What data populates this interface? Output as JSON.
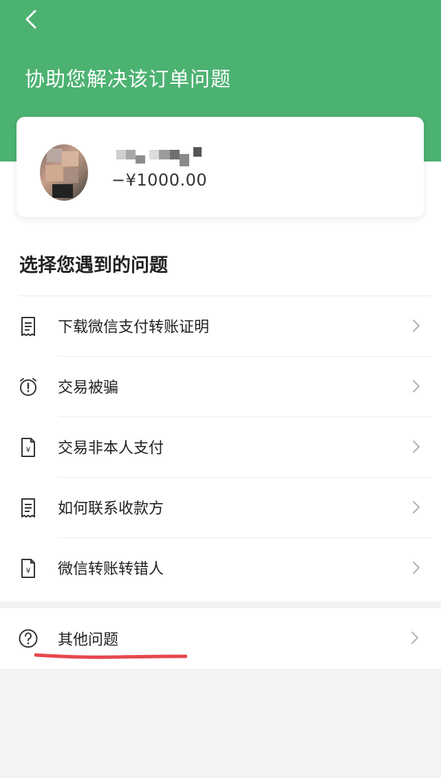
{
  "header": {
    "title": "协助您解决该订单问题",
    "back_icon": "chevron-left-icon",
    "background": "#4cb271"
  },
  "order": {
    "amount": "−¥1000.00"
  },
  "section": {
    "title": "选择您遇到的问题"
  },
  "problems": [
    {
      "label": "下载微信支付转账证明",
      "icon": "receipt-icon"
    },
    {
      "label": "交易被骗",
      "icon": "alert-clock-icon"
    },
    {
      "label": "交易非本人支付",
      "icon": "yuan-document-icon"
    },
    {
      "label": "如何联系收款方",
      "icon": "receipt-icon"
    },
    {
      "label": "微信转账转错人",
      "icon": "yuan-document-icon"
    }
  ],
  "other": {
    "label": "其他问题",
    "icon": "question-circle-icon",
    "underline_color": "#e5484d"
  }
}
